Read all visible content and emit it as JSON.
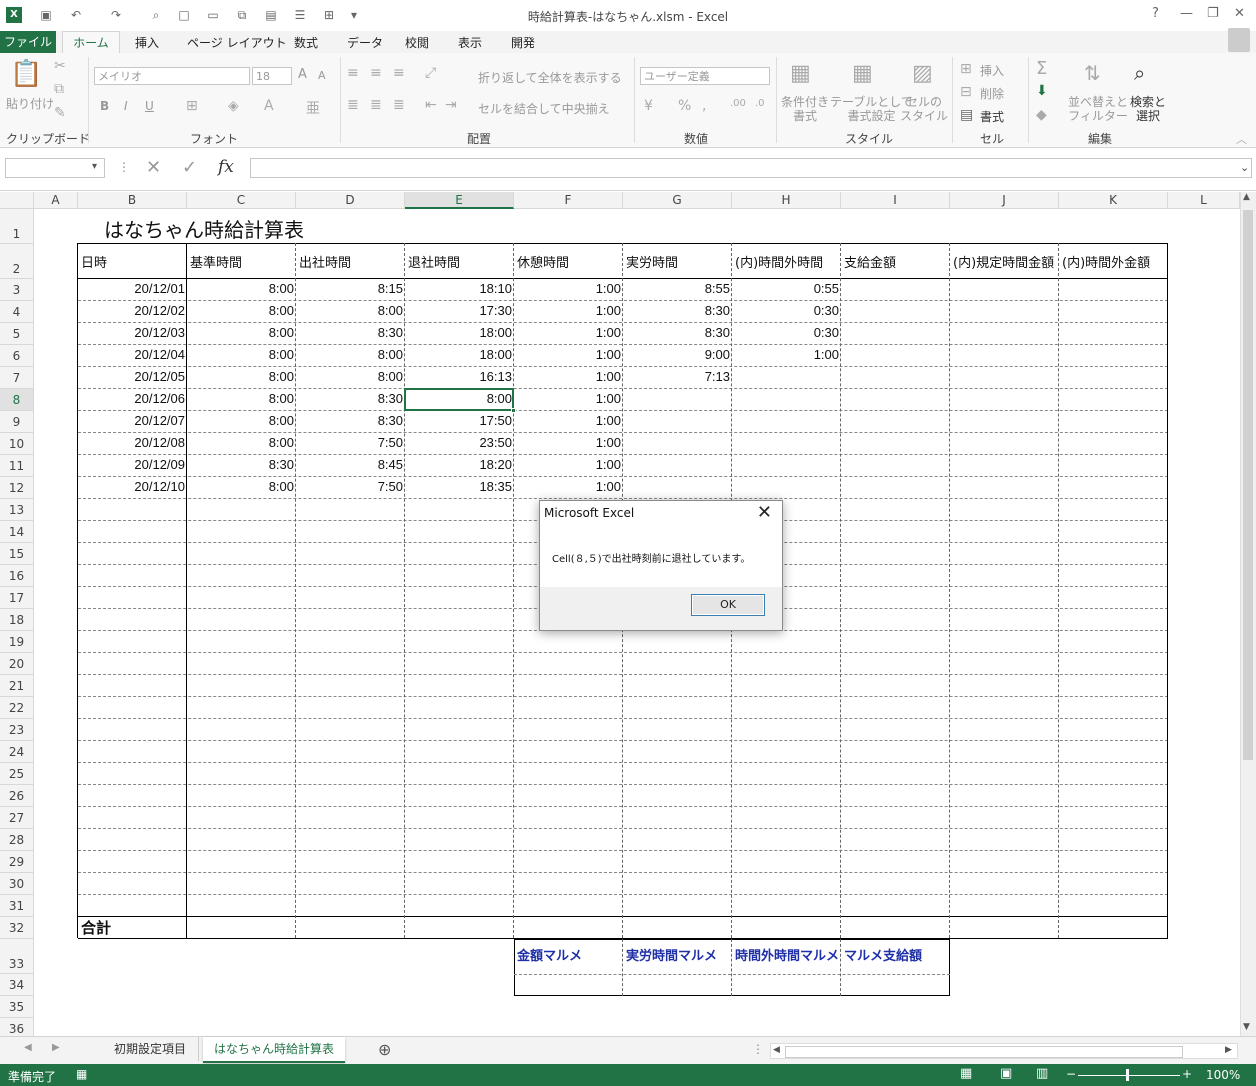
{
  "window": {
    "title": "時給計算表-はなちゃん.xlsm - Excel",
    "app_icon": "excel-logo"
  },
  "ribbon_tabs": [
    "ファイル",
    "ホーム",
    "挿入",
    "ページ レイアウト",
    "数式",
    "データ",
    "校閲",
    "表示",
    "開発"
  ],
  "ribbon": {
    "clipboard": {
      "paste": "貼り付け",
      "label": "クリップボード"
    },
    "font": {
      "name": "メイリオ",
      "size": "18",
      "label": "フォント",
      "grow": "A",
      "shrink": "A",
      "bold": "B",
      "italic": "I",
      "underline": "U"
    },
    "alignment": {
      "wrap": "折り返して全体を表示する",
      "merge": "セルを結合して中央揃え",
      "label": "配置"
    },
    "number": {
      "format": "ユーザー定義",
      "label": "数値"
    },
    "styles": {
      "conditional": "条件付き\n書式",
      "table": "テーブルとして\n書式設定",
      "cell": "セルの\nスタイル",
      "label": "スタイル"
    },
    "cells": {
      "insert": "挿入",
      "delete": "削除",
      "format": "書式",
      "label": "セル"
    },
    "editing": {
      "sort": "並べ替えと\nフィルター",
      "find": "検索と\n選択",
      "label": "編集"
    }
  },
  "formula_bar": {
    "name_box": "",
    "fx": "fx",
    "value": ""
  },
  "columns": [
    "A",
    "B",
    "C",
    "D",
    "E",
    "F",
    "G",
    "H",
    "I",
    "J",
    "K",
    "L"
  ],
  "selected_column": "E",
  "selected_row": 8,
  "sheet": {
    "title": "はなちゃん時給計算表",
    "headers": [
      "日時",
      "基準時間",
      "出社時間",
      "退社時間",
      "休憩時間",
      "実労時間",
      "(内)時間外時間",
      "支給金額",
      "(内)規定時間金額",
      "(内)時間外金額"
    ],
    "rows": [
      [
        "20/12/01",
        "8:00",
        "8:15",
        "18:10",
        "1:00",
        "8:55",
        "0:55"
      ],
      [
        "20/12/02",
        "8:00",
        "8:00",
        "17:30",
        "1:00",
        "8:30",
        "0:30"
      ],
      [
        "20/12/03",
        "8:00",
        "8:30",
        "18:00",
        "1:00",
        "8:30",
        "0:30"
      ],
      [
        "20/12/04",
        "8:00",
        "8:00",
        "18:00",
        "1:00",
        "9:00",
        "1:00"
      ],
      [
        "20/12/05",
        "8:00",
        "8:00",
        "16:13",
        "1:00",
        "7:13",
        ""
      ],
      [
        "20/12/06",
        "8:00",
        "8:30",
        "8:00",
        "1:00",
        "",
        ""
      ],
      [
        "20/12/07",
        "8:00",
        "8:30",
        "17:50",
        "1:00",
        "",
        ""
      ],
      [
        "20/12/08",
        "8:00",
        "7:50",
        "23:50",
        "1:00",
        "",
        ""
      ],
      [
        "20/12/09",
        "8:30",
        "8:45",
        "18:20",
        "1:00",
        "",
        ""
      ],
      [
        "20/12/10",
        "8:00",
        "7:50",
        "18:35",
        "1:00",
        "",
        ""
      ]
    ],
    "total_label": "合計",
    "summary_headers": [
      "金額マルメ",
      "実労時間マルメ",
      "時間外時間マルメ",
      "マルメ支給額"
    ]
  },
  "dialog": {
    "title": "Microsoft Excel",
    "message": "Cell(８,５)で出社時刻前に退社しています。",
    "ok": "OK"
  },
  "sheet_tabs": [
    "初期設定項目",
    "はなちゃん時給計算表"
  ],
  "active_sheet_tab": "はなちゃん時給計算表",
  "status": {
    "ready": "準備完了",
    "zoom": "100%"
  },
  "colors": {
    "excel_green": "#217346",
    "summary_blue": "#1f2fa8"
  }
}
